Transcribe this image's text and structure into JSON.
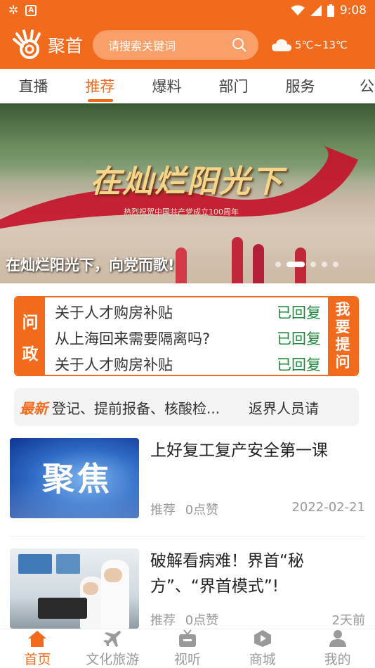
{
  "status_bar": {
    "time": "9:08",
    "icons": [
      "sync-icon",
      "a-box-icon",
      "wifi-icon",
      "signal-icon",
      "battery-icon"
    ]
  },
  "header": {
    "app_name": "聚首",
    "search_placeholder": "请搜索关键词",
    "weather": {
      "icon": "cloud-icon",
      "temp": "5℃~13℃"
    }
  },
  "tabs": [
    {
      "label": "直播",
      "active": false
    },
    {
      "label": "推荐",
      "active": true
    },
    {
      "label": "爆料",
      "active": false
    },
    {
      "label": "部门",
      "active": false
    },
    {
      "label": "服务",
      "active": false
    },
    {
      "label": "公",
      "active": false
    }
  ],
  "banner": {
    "headline": "在灿烂阳光下",
    "subheadline": "热烈祝贺中国共产党成立100周年",
    "caption": "在灿烂阳光下，向党而歌!",
    "slides": 5,
    "active_slide": 2
  },
  "wenzheng": {
    "left_label": [
      "问",
      "政"
    ],
    "items": [
      {
        "question": "关于人才购房补贴",
        "status": "已回复"
      },
      {
        "question": "从上海回来需要隔离吗?",
        "status": "已回复"
      },
      {
        "question": "关于人才购房补贴",
        "status": "已回复"
      }
    ],
    "ask_label": [
      "我",
      "要",
      "提",
      "问"
    ]
  },
  "ticker": {
    "tag": "最新",
    "items": [
      "登记、提前报备、核酸检...",
      "返界人员请"
    ]
  },
  "news": [
    {
      "thumb_text": "聚焦",
      "title": "上好复工复产安全第一课",
      "category": "推荐",
      "likes": "0点赞",
      "time": "2022-02-21"
    },
    {
      "thumb_text": "",
      "title": "破解看病难！界首“秘方”、“界首模式”!",
      "category": "推荐",
      "likes": "0点赞",
      "time": "2天前"
    }
  ],
  "bottom_nav": [
    {
      "label": "首页",
      "icon": "home-icon",
      "active": true
    },
    {
      "label": "文化旅游",
      "icon": "plane-icon",
      "active": false
    },
    {
      "label": "视听",
      "icon": "tv-icon",
      "active": false
    },
    {
      "label": "商城",
      "icon": "play-shop-icon",
      "active": false
    },
    {
      "label": "我的",
      "icon": "user-icon",
      "active": false
    }
  ],
  "colors": {
    "brand": "#f26b1d",
    "replied": "#1e8a3a"
  }
}
